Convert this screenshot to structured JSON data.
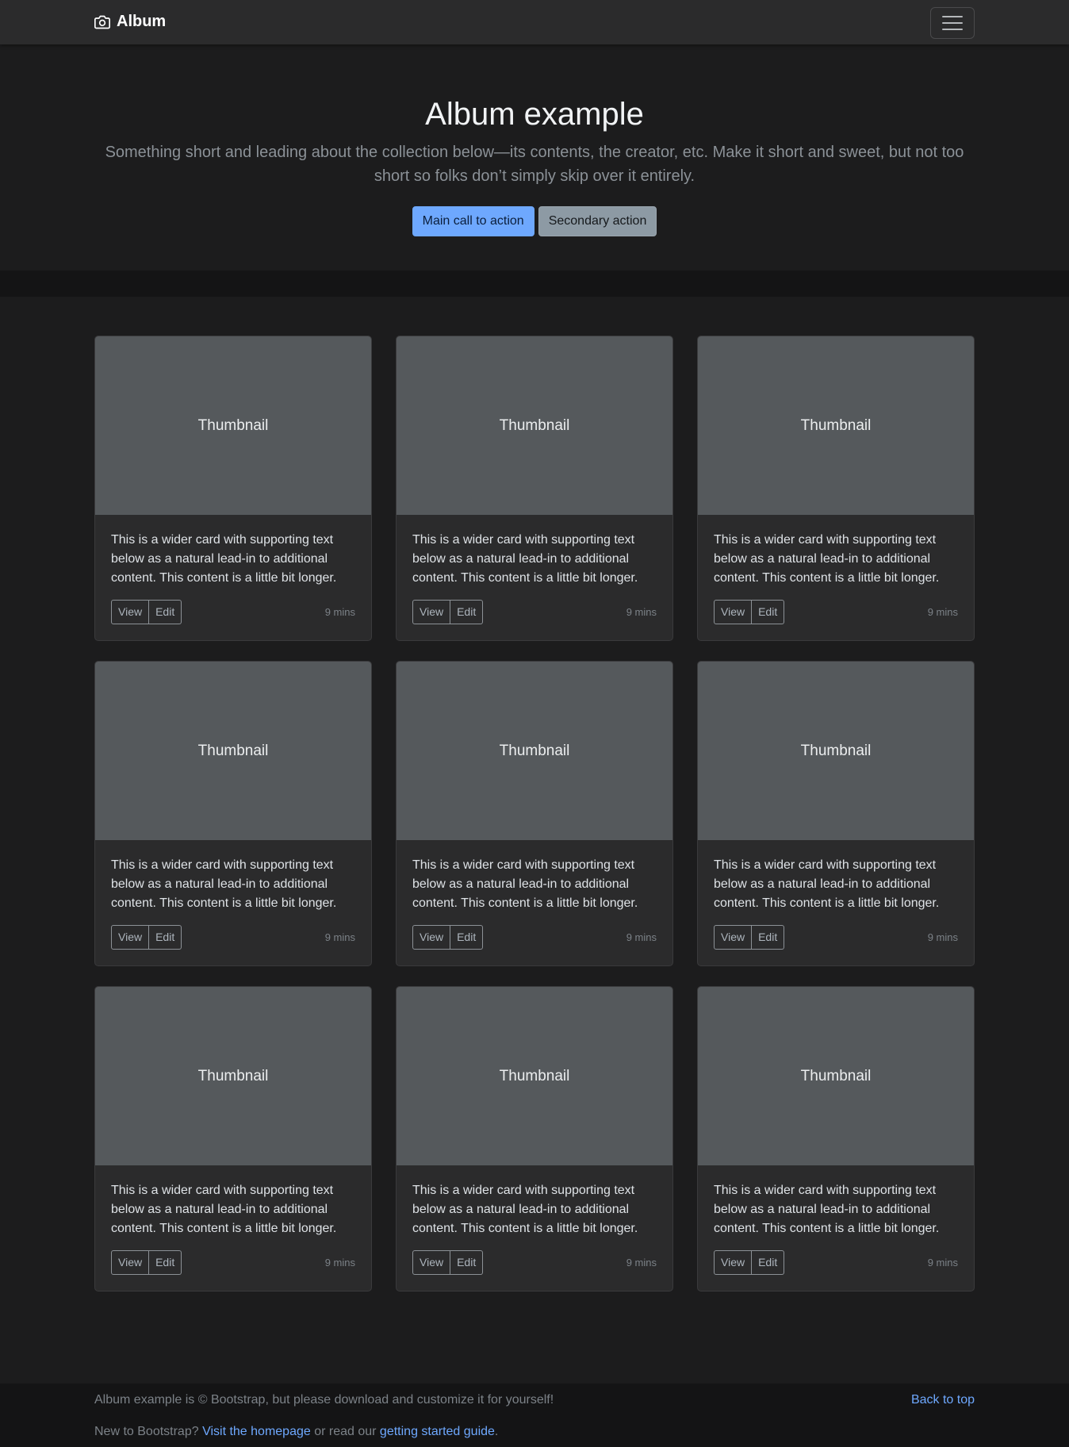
{
  "navbar": {
    "brand": "Album",
    "brand_icon": "camera-icon",
    "toggler_icon": "hamburger-icon"
  },
  "hero": {
    "title": "Album example",
    "lead": "Something short and leading about the collection below—its contents, the creator, etc. Make it short and sweet, but not too short so folks don’t simply skip over it entirely.",
    "primary_label": "Main call to action",
    "secondary_label": "Secondary action"
  },
  "cards": [
    {
      "thumb": "Thumbnail",
      "text": "This is a wider card with supporting text below as a natural lead-in to additional content. This content is a little bit longer.",
      "view": "View",
      "edit": "Edit",
      "time": "9 mins"
    },
    {
      "thumb": "Thumbnail",
      "text": "This is a wider card with supporting text below as a natural lead-in to additional content. This content is a little bit longer.",
      "view": "View",
      "edit": "Edit",
      "time": "9 mins"
    },
    {
      "thumb": "Thumbnail",
      "text": "This is a wider card with supporting text below as a natural lead-in to additional content. This content is a little bit longer.",
      "view": "View",
      "edit": "Edit",
      "time": "9 mins"
    },
    {
      "thumb": "Thumbnail",
      "text": "This is a wider card with supporting text below as a natural lead-in to additional content. This content is a little bit longer.",
      "view": "View",
      "edit": "Edit",
      "time": "9 mins"
    },
    {
      "thumb": "Thumbnail",
      "text": "This is a wider card with supporting text below as a natural lead-in to additional content. This content is a little bit longer.",
      "view": "View",
      "edit": "Edit",
      "time": "9 mins"
    },
    {
      "thumb": "Thumbnail",
      "text": "This is a wider card with supporting text below as a natural lead-in to additional content. This content is a little bit longer.",
      "view": "View",
      "edit": "Edit",
      "time": "9 mins"
    },
    {
      "thumb": "Thumbnail",
      "text": "This is a wider card with supporting text below as a natural lead-in to additional content. This content is a little bit longer.",
      "view": "View",
      "edit": "Edit",
      "time": "9 mins"
    },
    {
      "thumb": "Thumbnail",
      "text": "This is a wider card with supporting text below as a natural lead-in to additional content. This content is a little bit longer.",
      "view": "View",
      "edit": "Edit",
      "time": "9 mins"
    },
    {
      "thumb": "Thumbnail",
      "text": "This is a wider card with supporting text below as a natural lead-in to additional content. This content is a little bit longer.",
      "view": "View",
      "edit": "Edit",
      "time": "9 mins"
    }
  ],
  "footer": {
    "copyright": "Album example is © Bootstrap, but please download and customize it for yourself!",
    "back_to_top": "Back to top",
    "new_prefix": "New to Bootstrap? ",
    "homepage_link": "Visit the homepage",
    "middle": " or read our ",
    "guide_link": "getting started guide",
    "suffix": "."
  },
  "colors": {
    "primary": "#6ea8fe",
    "secondary": "#8d9aa4",
    "background": "#1c1c1d",
    "thumbnail": "#55595c"
  }
}
